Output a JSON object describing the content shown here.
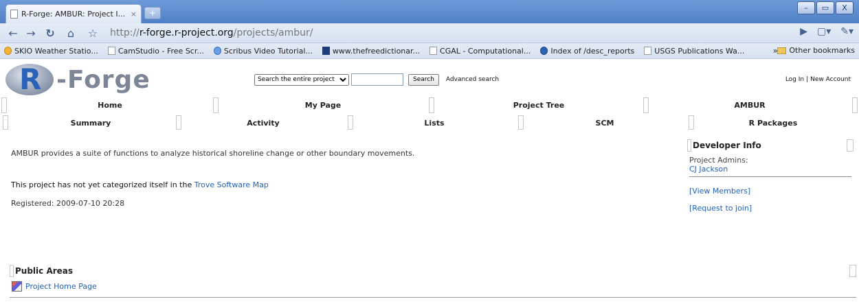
{
  "browser": {
    "tab_title": "R-Forge: AMBUR: Project I...",
    "tab_close": "×",
    "new_tab": "+",
    "url_scheme": "http://",
    "url_host": "r-forge.r-project.org",
    "url_path": "/projects/ambur/",
    "window_buttons": [
      "–",
      "▭",
      "X"
    ],
    "bookmarks": [
      {
        "label": "SKIO Weather Statio...",
        "icon": "sun-icon"
      },
      {
        "label": "CamStudio - Free Scr...",
        "icon": "page-icon"
      },
      {
        "label": "Scribus Video Tutorial...",
        "icon": "video-icon"
      },
      {
        "label": "www.thefreedictionar...",
        "icon": "tfd-icon"
      },
      {
        "label": "CGAL - Computational...",
        "icon": "page-icon"
      },
      {
        "label": "Index of /desc_reports",
        "icon": "noaa-icon"
      },
      {
        "label": "USGS Publications Wa...",
        "icon": "page-icon"
      }
    ],
    "more_bookmarks": "»",
    "other_bookmarks": "Other bookmarks"
  },
  "header": {
    "logo_letter": "R",
    "logo_text": "-Forge",
    "search_scope": "Search the entire project",
    "search_value": "",
    "search_button": "Search",
    "advanced_search": "Advanced search",
    "login": "Log In",
    "separator": "|",
    "new_account": "New Account"
  },
  "nav_top": [
    "Home",
    "My Page",
    "Project Tree",
    "AMBUR"
  ],
  "nav_sub": [
    "Summary",
    "Activity",
    "Lists",
    "SCM",
    "R Packages"
  ],
  "project": {
    "description": "AMBUR provides a suite of functions to analyze historical shoreline change or other boundary movements.",
    "trove_prefix": "This project has not yet categorized itself in the ",
    "trove_link": "Trove Software Map",
    "registered": "Registered: 2009-07-10 20:28"
  },
  "developer_info": {
    "title": "Developer Info",
    "admins_label": "Project Admins:",
    "admin": "CJ Jackson",
    "view_members": "[View Members]",
    "request_join": "[Request to join]"
  },
  "public_areas": {
    "title": "Public Areas",
    "home_page": "Project Home Page"
  }
}
